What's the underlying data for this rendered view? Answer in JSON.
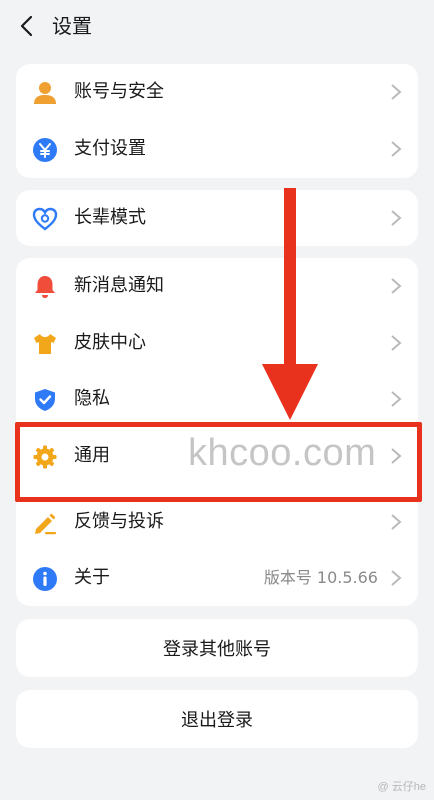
{
  "header": {
    "title": "设置"
  },
  "groups": {
    "account": [
      {
        "label": "账号与安全",
        "icon": "person-icon",
        "color": "#f0a030"
      },
      {
        "label": "支付设置",
        "icon": "yuan-icon",
        "color": "#2f7af6"
      }
    ],
    "elder": [
      {
        "label": "长辈模式",
        "icon": "heart-icon",
        "color": "#2f7af6"
      }
    ],
    "general": [
      {
        "label": "新消息通知",
        "icon": "bell-icon",
        "color": "#f04d3a"
      },
      {
        "label": "皮肤中心",
        "icon": "shirt-icon",
        "color": "#f2a61a"
      },
      {
        "label": "隐私",
        "icon": "shield-check-icon",
        "color": "#2f7af6"
      },
      {
        "label": "通用",
        "icon": "gear-icon",
        "color": "#f2a61a"
      },
      {
        "label": "反馈与投诉",
        "icon": "pencil-icon",
        "color": "#f2a61a"
      },
      {
        "label": "关于",
        "icon": "info-icon",
        "color": "#2f7af6",
        "value": "版本号 10.5.66"
      }
    ]
  },
  "buttons": {
    "login_other": "登录其他账号",
    "logout": "退出登录"
  },
  "overlay": {
    "watermark": "khcoo.com",
    "arrow_color": "#e8321e",
    "corner_watermark": "@ 云仔he"
  }
}
